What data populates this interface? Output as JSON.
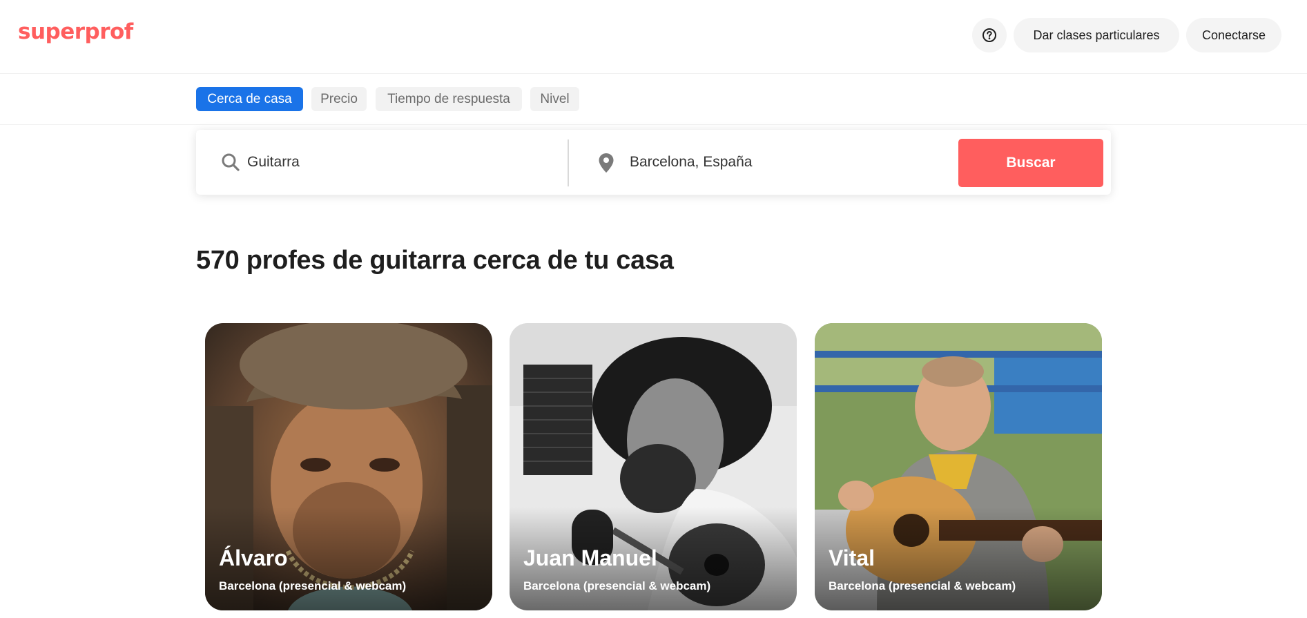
{
  "header": {
    "logo": "superprof",
    "teach_label": "Dar clases particulares",
    "login_label": "Conectarse"
  },
  "filters": [
    {
      "label": "Cerca de casa",
      "active": true
    },
    {
      "label": "Precio",
      "active": false
    },
    {
      "label": "Tiempo de respuesta",
      "active": false
    },
    {
      "label": "Nivel",
      "active": false
    }
  ],
  "search": {
    "subject_value": "Guitarra",
    "location_value": "Barcelona, España",
    "button_label": "Buscar"
  },
  "results": {
    "title": "570 profes de guitarra cerca de tu casa"
  },
  "tutors": [
    {
      "name": "Álvaro",
      "location": "Barcelona (presencial & webcam)"
    },
    {
      "name": "Juan Manuel",
      "location": "Barcelona (presencial & webcam)"
    },
    {
      "name": "Vital",
      "location": "Barcelona (presencial & webcam)"
    }
  ],
  "colors": {
    "brand": "#ff5e5e",
    "active_chip": "#1a73e8"
  }
}
